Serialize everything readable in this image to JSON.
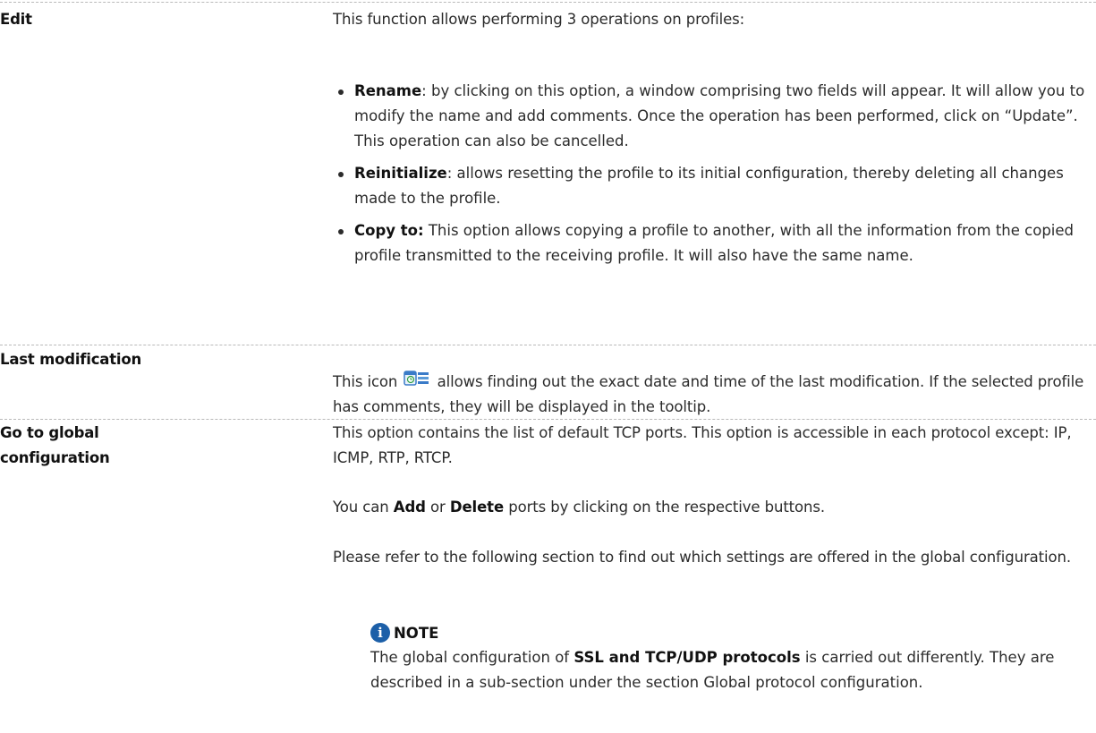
{
  "rows": [
    {
      "term": "Edit",
      "intro": "This function allows performing 3 operations on profiles:",
      "bullets": [
        {
          "bold": "Rename",
          "text": ": by clicking on this option, a window comprising two fields will appear. It will allow you to modify the name and add comments. Once the operation has been performed, click on “Update”. This operation can also be cancelled."
        },
        {
          "bold": "Reinitialize",
          "text": ": allows resetting the profile to its initial configuration, thereby deleting all changes made to the profile."
        },
        {
          "bold": "Copy to:",
          "text": " This option allows copying a profile to another, with all the information from the copied profile transmitted to the receiving profile. It will also have the same name."
        }
      ]
    },
    {
      "term": "Last modification",
      "text_before_icon": "This icon",
      "icon": "calendar-clock-icon",
      "text_after_icon": "allows finding out the exact date and time of the last modification. If the selected profile has comments, they will be displayed in the tooltip."
    },
    {
      "term_line1": "Go to global",
      "term_line2": "configuration",
      "para1": "This option contains the list of default TCP ports. This option is accessible in each protocol except: IP, ICMP, RTP, RTCP.",
      "para2_prefix": "You can ",
      "para2_add": "Add",
      "para2_or": " or ",
      "para2_delete": "Delete",
      "para2_suffix": " ports by clicking on the respective buttons.",
      "para3": "Please refer to the following section to find out which settings are offered in the global configuration.",
      "note": {
        "icon": "info-icon",
        "title": "NOTE",
        "body_prefix": "The global configuration of ",
        "body_bold": "SSL and TCP/UDP protocols",
        "body_suffix": " is carried out differently. They are described in a sub-section under the section Global protocol configuration."
      }
    }
  ],
  "colors": {
    "text": "#2b2b2b",
    "divider": "#b9b9b9",
    "note_icon": "#1c5fa8"
  }
}
